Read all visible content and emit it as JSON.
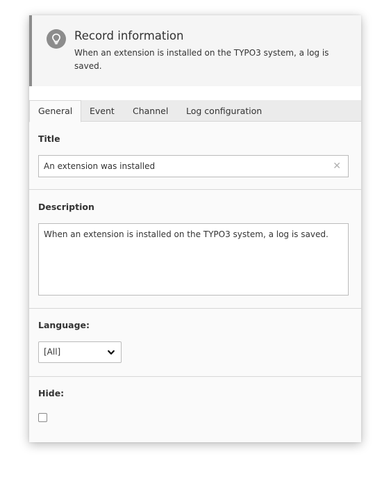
{
  "callout": {
    "title": "Record information",
    "text": "When an extension is installed on the TYPO3 system, a log is saved.",
    "icon": "lightbulb-icon"
  },
  "tabs": [
    {
      "label": "General",
      "active": true
    },
    {
      "label": "Event",
      "active": false
    },
    {
      "label": "Channel",
      "active": false
    },
    {
      "label": "Log configuration",
      "active": false
    }
  ],
  "fields": {
    "title": {
      "label": "Title",
      "value": "An extension was installed",
      "clear_icon": "close-icon"
    },
    "description": {
      "label": "Description",
      "value": "When an extension is installed on the TYPO3 system, a log is saved."
    },
    "language": {
      "label": "Language:",
      "selected": "[All]"
    },
    "hide": {
      "label": "Hide:",
      "checked": false
    }
  }
}
